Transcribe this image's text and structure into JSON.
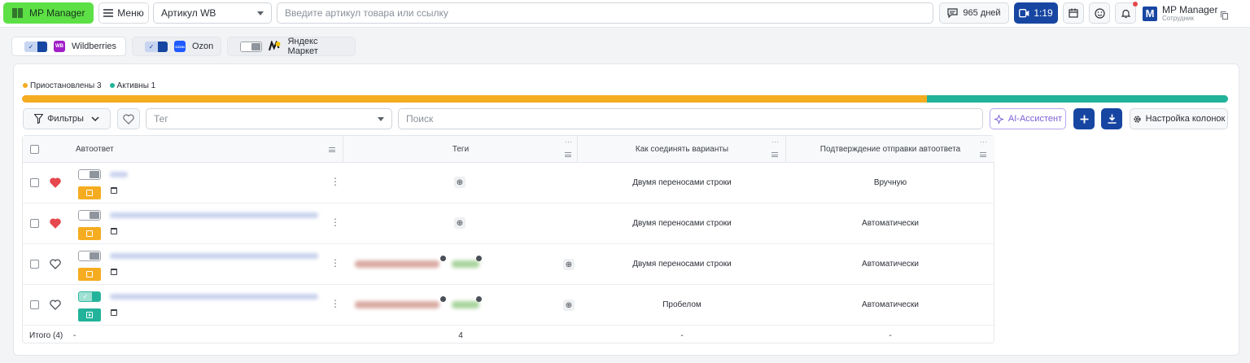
{
  "header": {
    "logo_label": "MP Manager",
    "menu_label": "Меню",
    "article_select": "Артикул WB",
    "search_placeholder": "Введите артикул товара или ссылку",
    "days_label": "965 дней",
    "timer_label": "1:19",
    "user_name": "MP Manager",
    "user_role": "Сотрудник",
    "user_avatar": "M"
  },
  "marketplaces": [
    {
      "name": "Wildberries",
      "logo": "WB",
      "enabled": true,
      "color": "#a01fc8"
    },
    {
      "name": "Ozon",
      "logo": "OZON",
      "enabled": true,
      "color": "#1f5bff"
    },
    {
      "name": "Яндекс Маркет",
      "logo": "ЯМ",
      "enabled": false,
      "color": "#f5c400"
    }
  ],
  "status_legend": {
    "paused_label": "Приостановлены 3",
    "active_label": "Активны 1",
    "paused_color": "#f5ac20",
    "active_color": "#22b39a",
    "paused_share": 0.75,
    "active_share": 0.25
  },
  "toolbar": {
    "filters_label": "Фильтры",
    "tag_placeholder": "Тег",
    "search_placeholder": "Поиск",
    "ai_label": "AI-Ассистент",
    "columns_label": "Настройка колонок"
  },
  "table": {
    "columns": [
      "Автоответ",
      "Теги",
      "Как соединять варианты",
      "Подтверждение отправки автоответа"
    ],
    "rows": [
      {
        "favorite": true,
        "enabled": false,
        "status": "paused",
        "has_tags": false,
        "join": "Двумя переносами строки",
        "confirm": "Вручную"
      },
      {
        "favorite": true,
        "enabled": false,
        "status": "paused",
        "has_tags": false,
        "join": "Двумя переносами строки",
        "confirm": "Автоматически"
      },
      {
        "favorite": false,
        "enabled": false,
        "status": "paused",
        "has_tags": true,
        "join": "Двумя переносами строки",
        "confirm": "Автоматически"
      },
      {
        "favorite": false,
        "enabled": true,
        "status": "active",
        "has_tags": true,
        "join": "Пробелом",
        "confirm": "Автоматически"
      }
    ],
    "footer": {
      "total_label": "Итого (4)",
      "autoreply": "-",
      "tags": "4",
      "join": "-",
      "confirm": "-"
    }
  },
  "icons": [
    "barcode-icon",
    "menu-icon",
    "chat-icon",
    "video-icon",
    "calendar-icon",
    "smiley-icon",
    "bell-icon",
    "copy-icon",
    "filter-icon",
    "heart-icon",
    "sparkle-icon",
    "plus-icon",
    "download-icon",
    "gear-icon",
    "kebab-icon"
  ]
}
